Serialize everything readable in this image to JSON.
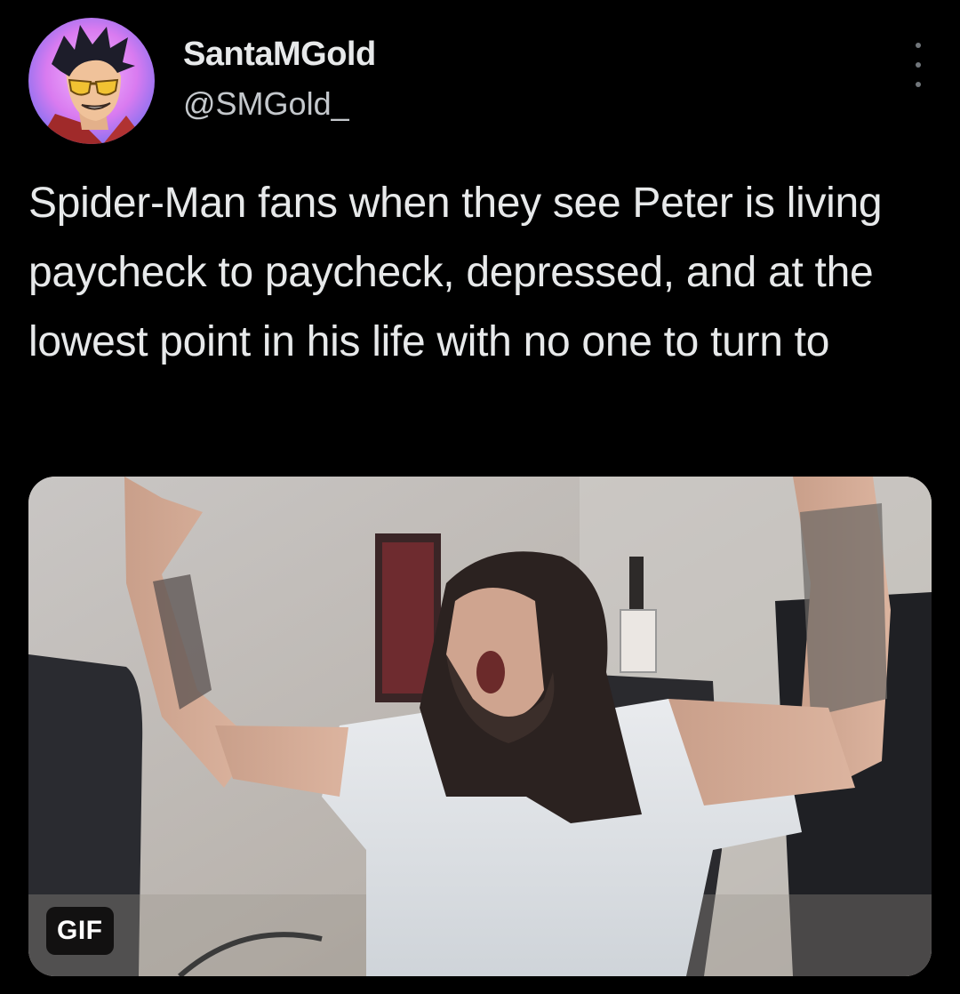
{
  "tweet": {
    "display_name": "SantaMGold",
    "handle": "@SMGold_",
    "text": "Spider-Man fans when they see Peter is living paycheck to paycheck, depressed, and at the lowest point in his life with no one to turn to",
    "media": {
      "badge": "GIF"
    }
  },
  "icons": {
    "avatar": "avatar-illustrated-man-sunglasses",
    "more": "more-options-icon"
  },
  "colors": {
    "background": "#000000",
    "text_primary": "#e7e9ea",
    "text_secondary": "#c4c8cc",
    "icon_muted": "#71767b"
  }
}
